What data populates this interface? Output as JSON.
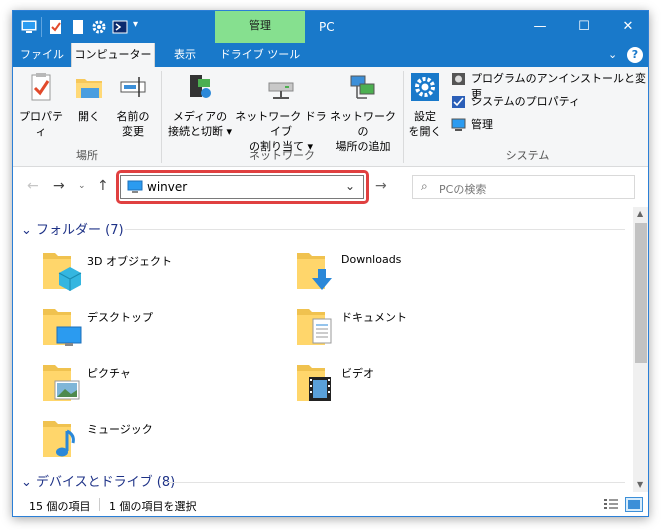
{
  "title_bar": {
    "context_tab_label": "管理",
    "title": "PC",
    "minimize_glyph": "—",
    "maximize_glyph": "☐",
    "close_glyph": "✕"
  },
  "ribbon_tabs": {
    "file": "ファイル",
    "computer": "コンピューター",
    "view": "表示",
    "drive_tools": "ドライブ ツール",
    "help_glyph": "?"
  },
  "ribbon": {
    "location": {
      "properties": "プロパティ",
      "open": "開く",
      "rename_line1": "名前の",
      "rename_line2": "変更",
      "group_label": "場所"
    },
    "network": {
      "media_line1": "メディアの",
      "media_line2": "接続と切断",
      "map_drive_line1": "ネットワーク ドライブ",
      "map_drive_line2": "の割り当て",
      "add_location_line1": "ネットワークの",
      "add_location_line2": "場所の追加",
      "group_label": "ネットワーク"
    },
    "system": {
      "settings_line1": "設定",
      "settings_line2": "を開く",
      "uninstall": "プログラムのアンインストールと変更",
      "system_properties": "システムのプロパティ",
      "manage": "管理",
      "group_label": "システム"
    }
  },
  "address_bar": {
    "value": "winver",
    "search_placeholder": "PCの検索"
  },
  "groups": {
    "folders_header": "フォルダー (7)",
    "devices_header": "デバイスとドライブ (8)"
  },
  "folders": [
    {
      "name": "3D オブジェクト",
      "icon": "3d-objects-icon"
    },
    {
      "name": "Downloads",
      "icon": "downloads-icon"
    },
    {
      "name": "デスクトップ",
      "icon": "desktop-icon"
    },
    {
      "name": "ドキュメント",
      "icon": "documents-icon"
    },
    {
      "name": "ピクチャ",
      "icon": "pictures-icon"
    },
    {
      "name": "ビデオ",
      "icon": "videos-icon"
    },
    {
      "name": "ミュージック",
      "icon": "music-icon"
    }
  ],
  "status": {
    "item_count": "15 個の項目",
    "selected": "1 個の項目を選択"
  },
  "colors": {
    "title_bar": "#1979ca",
    "context_tab": "#86e08f",
    "highlight": "#e04040",
    "group_header": "#1e3287"
  }
}
